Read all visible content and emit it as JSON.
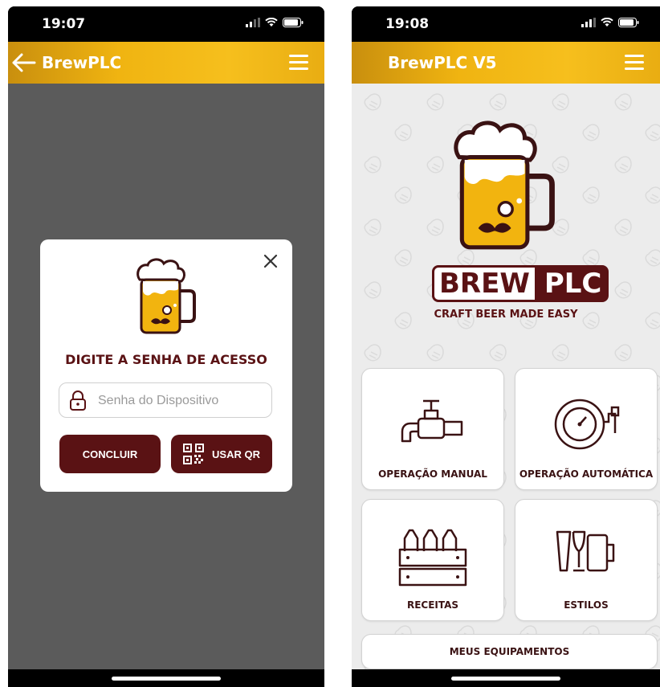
{
  "colors": {
    "accent": "#f0b411",
    "brand_dark": "#5a1214",
    "overlay": "#5b5b5b"
  },
  "left_screen": {
    "status": {
      "time": "19:07"
    },
    "appbar": {
      "title": "BrewPLC",
      "back_icon": "arrow-left-icon",
      "menu_icon": "hamburger-icon"
    },
    "dialog": {
      "prompt": "DIGITE A SENHA DE ACESSO",
      "password": {
        "value": "",
        "placeholder": "Senha do Dispositivo"
      },
      "confirm_label": "CONCLUIR",
      "qr_label": "USAR QR"
    }
  },
  "right_screen": {
    "status": {
      "time": "19:08"
    },
    "appbar": {
      "title": "BrewPLC V5",
      "menu_icon": "hamburger-icon"
    },
    "logo": {
      "word1": "BREW",
      "word2": "PLC",
      "tagline": "CRAFT BEER MADE EASY"
    },
    "tiles": {
      "manual": "OPERAÇÃO MANUAL",
      "auto": "OPERAÇÃO AUTOMÁTICA",
      "recipes": "RECEITAS",
      "styles": "ESTILOS",
      "equipment": "MEUS EQUIPAMENTOS"
    }
  }
}
